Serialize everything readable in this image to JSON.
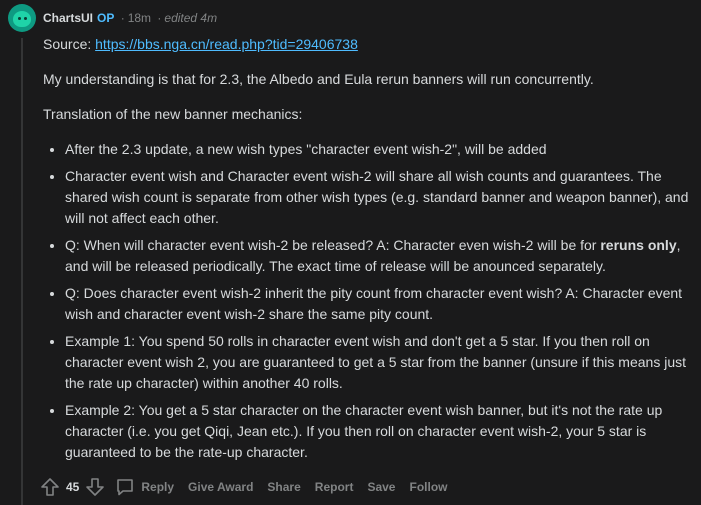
{
  "comment": {
    "author": "ChartsUI",
    "op_badge": "OP",
    "separator": "·",
    "time": "18m",
    "edited": "edited 4m",
    "source_label": "Source: ",
    "source_link": "https://bbs.nga.cn/read.php?tid=29406738",
    "intro": "My understanding is that for 2.3, the Albedo and Eula rerun banners will run concurrently.",
    "translation_heading": "Translation of the new banner mechanics:",
    "bullets": [
      "After the 2.3 update, a new wish types \"character event wish-2\", will be added",
      "Character event wish and Character event wish-2 will share all wish counts and guarantees. The shared wish count is separate from other wish types (e.g. standard banner and weapon banner), and will not affect each other.",
      "Q: When will character event wish-2 be released? A: Character even wish-2 will be for ",
      "Q: Does character event wish-2 inherit the pity count from character event wish? A: Character event wish and character event wish-2 share the same pity count.",
      "Example 1: You spend 50 rolls in character event wish and don't get a 5 star. If you then roll on character event wish 2, you are guaranteed to get a 5 star from the banner (unsure if this means just the rate up character) within another 40 rolls.",
      "Example 2: You get a 5 star character on the character event wish banner, but it's not the rate up character (i.e. you get Qiqi, Jean etc.). If you then roll on character event wish-2, your 5 star is guaranteed to be the rate-up character."
    ],
    "bullet3_bold": "reruns only",
    "bullet3_rest": ", and will be released periodically. The exact time of release will be anounced separately.",
    "score": "45",
    "actions": {
      "reply": "Reply",
      "give_award": "Give Award",
      "share": "Share",
      "report": "Report",
      "save": "Save",
      "follow": "Follow"
    }
  },
  "colors": {
    "background": "#1a1a1b",
    "text": "#d7dadc",
    "muted": "#818384",
    "link": "#4fbcff",
    "avatar": "#0e9a82"
  }
}
